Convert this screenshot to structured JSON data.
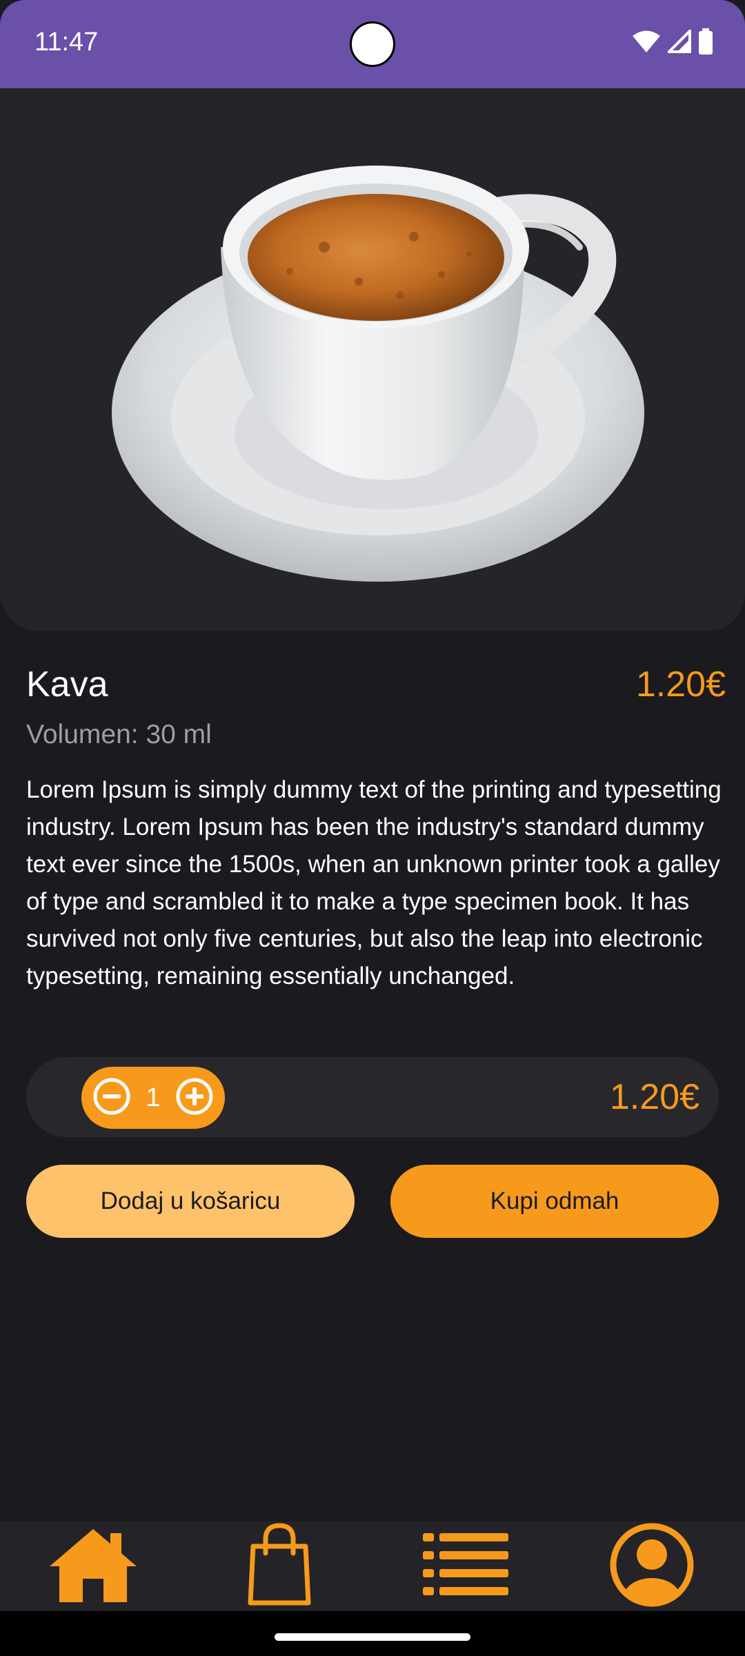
{
  "status_bar": {
    "time": "11:47"
  },
  "product": {
    "image_icon": "coffee-cup-image",
    "name": "Kava",
    "price": "1.20€",
    "volume": "Volumen: 30 ml",
    "description": "Lorem Ipsum is simply dummy text of the printing and typesetting industry. Lorem Ipsum has been the industry's standard dummy text ever since the 1500s, when an unknown printer took a galley of type and scrambled it to make a type specimen book. It has survived not only five centuries, but also the leap into electronic typesetting, remaining essentially unchanged."
  },
  "quantity": {
    "value": "1",
    "total": "1.20€",
    "decrement_icon": "minus-circle-icon",
    "increment_icon": "plus-circle-icon"
  },
  "actions": {
    "add_to_cart_label": "Dodaj u košaricu",
    "buy_now_label": "Kupi odmah"
  },
  "bottom_nav": {
    "items": [
      {
        "icon": "home-icon"
      },
      {
        "icon": "shopping-bag-icon"
      },
      {
        "icon": "list-icon"
      },
      {
        "icon": "account-icon"
      }
    ]
  },
  "colors": {
    "accent": "#f79a1b",
    "accent_light": "#fec26a",
    "status_bar": "#6a50a8",
    "background": "#1b1a1f",
    "surface": "#252429"
  }
}
